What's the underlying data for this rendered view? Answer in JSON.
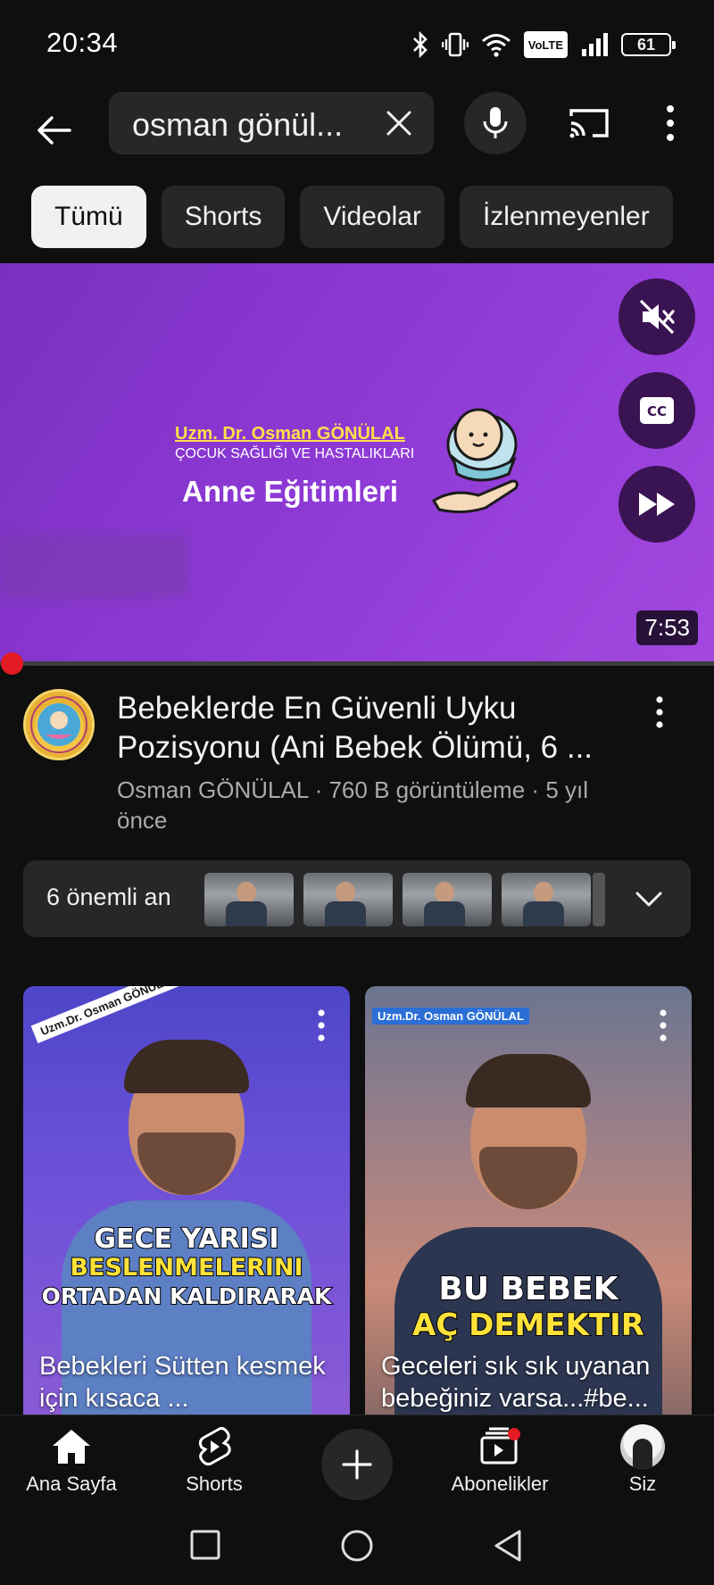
{
  "status_bar": {
    "time": "20:34",
    "battery": "61",
    "network_badge": "VoLTE"
  },
  "search": {
    "query": "osman gönül..."
  },
  "chips": [
    "Tümü",
    "Shorts",
    "Videolar",
    "İzlenmeyenler"
  ],
  "hero": {
    "brand_line1": "Uzm. Dr. Osman GÖNÜLAL",
    "brand_line2": "ÇOCUK SAĞLIĞI VE HASTALIKLARI",
    "brand_line3": "Anne Eğitimleri",
    "duration": "7:53"
  },
  "video": {
    "title": "Bebeklerde En Güvenli Uyku Pozisyonu (Ani Bebek Ölümü, 6 ...",
    "channel": "Osman GÖNÜLAL",
    "views": "760 B görüntüleme",
    "age": "5 yıl önce",
    "separator": "·"
  },
  "key_moments": {
    "label": "6 önemli an"
  },
  "shorts": [
    {
      "sticker": "Uzm.Dr. Osman GÖNÜLAL",
      "overlay_line1": "GECE YARISI",
      "overlay_line2": "BESLENMELERINI",
      "overlay_line3": "ORTADAN KALDIRARAK",
      "caption": "Bebekleri Sütten kesmek için kısaca ..."
    },
    {
      "sticker": "Uzm.Dr. Osman GÖNÜLAL",
      "overlay_line1": "BU BEBEK",
      "overlay_line2": "AÇ DEMEKTIR",
      "caption": "Geceleri sık sık uyanan bebeğiniz varsa...#be..."
    }
  ],
  "bottom_nav": {
    "home": "Ana Sayfa",
    "shorts": "Shorts",
    "subscriptions": "Abonelikler",
    "you": "Siz"
  },
  "colors": {
    "background": "#0f0f0f",
    "chip": "#272727",
    "chip_active": "#f1f1f1",
    "progress_red": "#e31b23",
    "hero_purple": "#8e3ad6"
  }
}
